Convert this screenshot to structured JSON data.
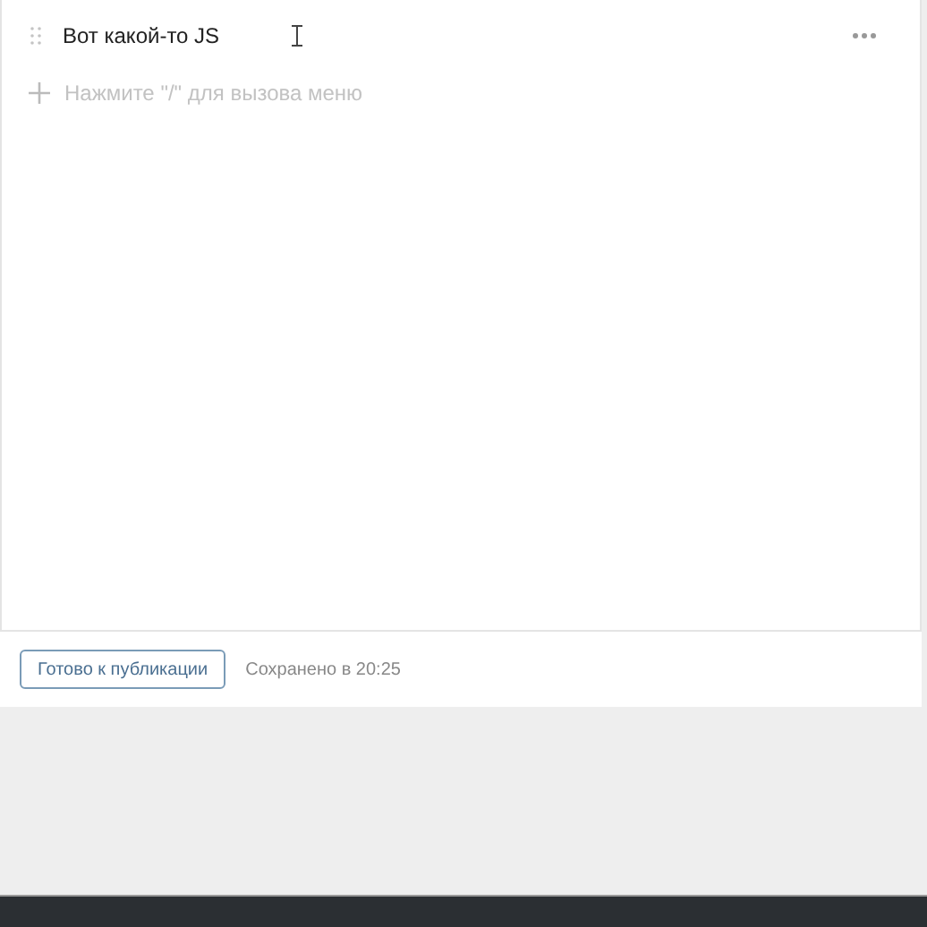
{
  "editor": {
    "blocks": [
      {
        "kind": "text",
        "text": "Вот какой-то JS"
      }
    ],
    "new_block_placeholder": "Нажмите \"/\" для вызова меню"
  },
  "footer": {
    "button": "Готово к публикации",
    "status": "Сохранено в 20:25"
  }
}
